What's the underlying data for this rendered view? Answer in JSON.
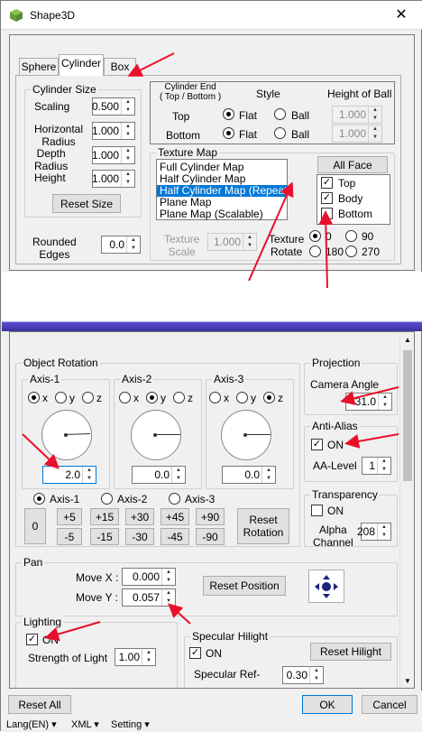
{
  "window": {
    "title": "Shape3D",
    "close": "✕"
  },
  "tabs": [
    {
      "label": "Sphere"
    },
    {
      "label": "Cylinder"
    },
    {
      "label": "Box"
    }
  ],
  "cylinder_size": {
    "title": "Cylinder Size",
    "scaling_label": "Scaling",
    "scaling": "0.500",
    "hradius_label": "Horizontal\nRadius",
    "hradius": "1.000",
    "dradius_label": "Depth\nRadius",
    "dradius": "1.000",
    "height_label": "Height",
    "height": "1.000",
    "reset": "Reset Size"
  },
  "rounded": {
    "label": "Rounded\nEdges",
    "value": "0.0"
  },
  "cylinder_end": {
    "header": "Cylinder End\n( Top / Bottom )",
    "style": "Style",
    "hob": "Height of Ball",
    "top": "Top",
    "bottom": "Bottom",
    "flat": "Flat",
    "ball": "Ball",
    "top_height": "1.000",
    "bottom_height": "1.000"
  },
  "texture_map": {
    "title": "Texture Map",
    "items": [
      "Full Cylinder Map",
      "Half Cylinder Map",
      "Half Cylinder Map (Repeat)",
      "Plane Map",
      "Plane Map (Scalable)"
    ],
    "all_face": "All Face",
    "faces": [
      "Top",
      "Body",
      "Bottom"
    ],
    "scale_label": "Texture\nScale",
    "scale": "1.000",
    "rotate_label": "Texture\nRotate",
    "rot": [
      "0",
      "90",
      "180",
      "270"
    ]
  },
  "object_rotation": {
    "title": "Object Rotation",
    "axes": [
      {
        "label": "Axis-1",
        "value": "2.0"
      },
      {
        "label": "Axis-2",
        "value": "0.0"
      },
      {
        "label": "Axis-3",
        "value": "0.0"
      }
    ],
    "xyz": [
      "x",
      "y",
      "z"
    ],
    "steps_top": [
      "+5",
      "+15",
      "+30",
      "+45",
      "+90"
    ],
    "steps_bottom": [
      "-5",
      "-15",
      "-30",
      "-45",
      "-90"
    ],
    "zero": "0",
    "reset": "Reset\nRotation"
  },
  "projection": {
    "title": "Projection",
    "camera_label": "Camera Angle",
    "camera": "31.0"
  },
  "antialias": {
    "title": "Anti-Alias",
    "on": "ON",
    "level_label": "AA-Level",
    "level": "1"
  },
  "transparency": {
    "title": "Transparency",
    "on": "ON",
    "alpha_label": "Alpha\nChannel",
    "alpha": "208"
  },
  "pan": {
    "title": "Pan",
    "movex_label": "Move X :",
    "movex": "0.000",
    "movey_label": "Move Y :",
    "movey": "0.057",
    "reset": "Reset Position"
  },
  "lighting": {
    "title": "Lighting",
    "on": "ON",
    "strength_label": "Strength of Light",
    "strength": "1.00"
  },
  "specular": {
    "title": "Specular Hilight",
    "on": "ON",
    "reset": "Reset Hilight",
    "ref_label": "Specular Ref-",
    "ref": "0.30"
  },
  "footer": {
    "reset_all": "Reset All",
    "ok": "OK",
    "cancel": "Cancel"
  },
  "menu": [
    "Lang(EN)",
    "XML",
    "Setting"
  ],
  "colors": {
    "accent": "#0078d7",
    "arrow": "#e8102a"
  }
}
